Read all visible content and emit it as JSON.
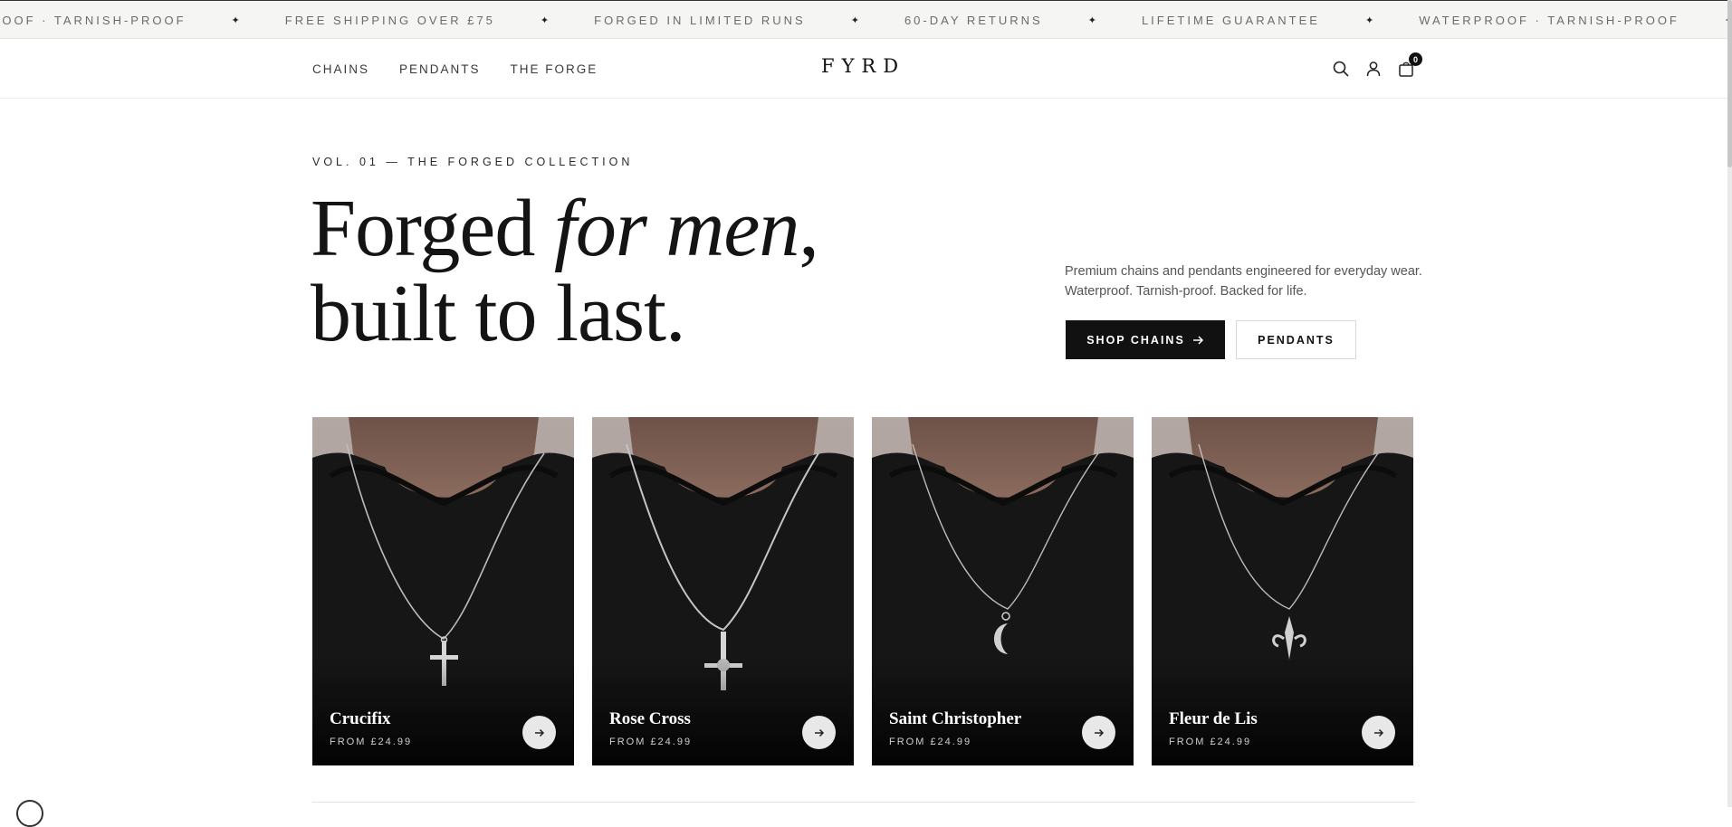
{
  "announcement": {
    "items": [
      "ROOF · TARNISH-PROOF",
      "FREE SHIPPING OVER £75",
      "FORGED IN LIMITED RUNS",
      "60-DAY RETURNS",
      "LIFETIME GUARANTEE",
      "WATERPROOF · TARNISH-PROOF"
    ],
    "separator": "✦"
  },
  "header": {
    "nav": [
      "CHAINS",
      "PENDANTS",
      "THE FORGE"
    ],
    "logo": "FYRD",
    "cart_count": "0",
    "icons": [
      "search-icon",
      "account-icon",
      "cart-icon"
    ]
  },
  "hero": {
    "eyebrow": "VOL. 01 — THE FORGED COLLECTION",
    "headline_part1": "Forged ",
    "headline_italic": "for men",
    "headline_part2": ",",
    "headline_line2": "built to last.",
    "description": "Premium chains and pendants engineered for everyday wear. Waterproof. Tarnish-proof. Backed for life.",
    "primary_cta": "SHOP CHAINS",
    "secondary_cta": "PENDANTS"
  },
  "products": [
    {
      "name": "Crucifix",
      "price": "FROM £24.99",
      "pendant": "crucifix"
    },
    {
      "name": "Rose Cross",
      "price": "FROM £24.99",
      "pendant": "cross"
    },
    {
      "name": "Saint Christopher",
      "price": "FROM £24.99",
      "pendant": "moon"
    },
    {
      "name": "Fleur de Lis",
      "price": "FROM £24.99",
      "pendant": "fleur"
    }
  ],
  "colors": {
    "ink": "#111111",
    "muted": "#555555",
    "banner_bg": "#f5f5f4"
  }
}
